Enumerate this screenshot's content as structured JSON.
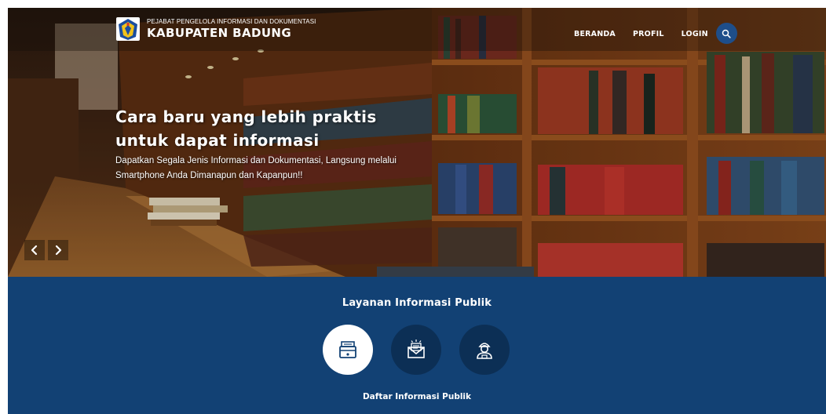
{
  "header": {
    "subtitle": "PEJABAT PENGELOLA INFORMASI DAN DOKUMENTASI",
    "title": "KABUPATEN BADUNG",
    "logo_icon": "badung-crest-icon"
  },
  "nav": {
    "items": [
      "BERANDA",
      "PROFIL",
      "LOGIN"
    ],
    "search_icon": "search-icon",
    "accent_color": "#1e4e8a"
  },
  "hero": {
    "heading": "Cara baru yang lebih praktis untuk dapat informasi",
    "description": "Dapatkan Segala Jenis Informasi dan Dokumentasi, Langsung melalui Smartphone Anda Dimanapun dan Kapanpun!!",
    "prev_icon": "chevron-left-icon",
    "next_icon": "chevron-right-icon"
  },
  "services": {
    "title": "Layanan Informasi Publik",
    "background_color": "#124174",
    "items": [
      {
        "icon": "archive-box-icon",
        "active": true
      },
      {
        "icon": "mail-envelope-icon",
        "active": false
      },
      {
        "icon": "officer-support-icon",
        "active": false
      }
    ],
    "active_caption": "Daftar Informasi Publik"
  }
}
